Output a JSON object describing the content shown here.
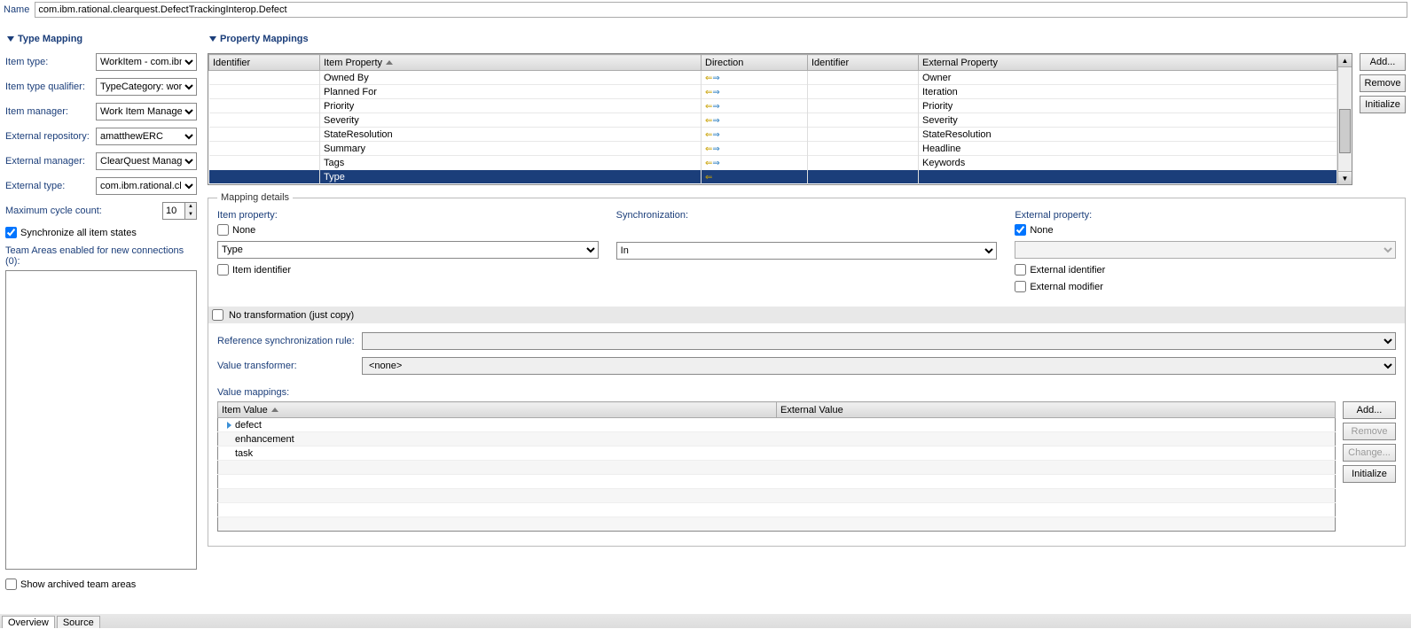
{
  "name": {
    "label": "Name",
    "value": "com.ibm.rational.clearquest.DefectTrackingInterop.Defect"
  },
  "typeMapping": {
    "header": "Type Mapping",
    "itemTypeLabel": "Item type:",
    "itemTypeValue": "WorkItem - com.ibm",
    "itemTypeQualifierLabel": "Item type qualifier:",
    "itemTypeQualifierValue": "TypeCategory: wor",
    "itemManagerLabel": "Item manager:",
    "itemManagerValue": "Work Item Manager",
    "externalRepoLabel": "External repository:",
    "externalRepoValue": "amatthewERC",
    "externalManagerLabel": "External manager:",
    "externalManagerValue": "ClearQuest Manage",
    "externalTypeLabel": "External type:",
    "externalTypeValue": "com.ibm.rational.cle",
    "maxCycleLabel": "Maximum cycle count:",
    "maxCycleValue": "10",
    "syncAllLabel": "Synchronize all item states",
    "teamAreasLabel": "Team Areas enabled for new connections (0):",
    "showArchivedLabel": "Show archived team areas"
  },
  "propertyMappings": {
    "header": "Property Mappings",
    "cols": {
      "identifier": "Identifier",
      "itemProperty": "Item Property",
      "direction": "Direction",
      "identifier2": "Identifier",
      "externalProperty": "External Property"
    },
    "rows": [
      {
        "itemProperty": "Owned By",
        "direction": "inout",
        "externalProperty": "Owner"
      },
      {
        "itemProperty": "Planned For",
        "direction": "inout",
        "externalProperty": "Iteration"
      },
      {
        "itemProperty": "Priority",
        "direction": "inout",
        "externalProperty": "Priority"
      },
      {
        "itemProperty": "Severity",
        "direction": "inout",
        "externalProperty": "Severity"
      },
      {
        "itemProperty": "StateResolution",
        "direction": "inout",
        "externalProperty": "StateResolution"
      },
      {
        "itemProperty": "Summary",
        "direction": "inout",
        "externalProperty": "Headline"
      },
      {
        "itemProperty": "Tags",
        "direction": "inout",
        "externalProperty": "Keywords"
      },
      {
        "itemProperty": "Type",
        "direction": "in",
        "externalProperty": "",
        "selected": true
      }
    ],
    "buttons": {
      "add": "Add...",
      "remove": "Remove",
      "initialize": "Initialize"
    }
  },
  "mappingDetails": {
    "legend": "Mapping details",
    "itemPropertyLabel": "Item property:",
    "noneLabel": "None",
    "itemPropertyValue": "Type",
    "itemIdentifierLabel": "Item identifier",
    "synchronizationLabel": "Synchronization:",
    "syncValue": "In",
    "externalPropertyLabel": "External property:",
    "externalNoneChecked": true,
    "externalIdentifierLabel": "External identifier",
    "externalModifierLabel": "External modifier",
    "noTransformLabel": "No transformation (just copy)",
    "refSyncRuleLabel": "Reference synchronization rule:",
    "refSyncRuleValue": "",
    "valueTransformerLabel": "Value transformer:",
    "valueTransformerValue": "<none>"
  },
  "valueMappings": {
    "label": "Value mappings:",
    "cols": {
      "itemValue": "Item Value",
      "externalValue": "External Value"
    },
    "rows": [
      {
        "itemValue": "defect",
        "marker": true
      },
      {
        "itemValue": "enhancement"
      },
      {
        "itemValue": "task"
      }
    ],
    "buttons": {
      "add": "Add...",
      "remove": "Remove",
      "change": "Change...",
      "initialize": "Initialize"
    }
  },
  "tabs": {
    "overview": "Overview",
    "source": "Source"
  }
}
